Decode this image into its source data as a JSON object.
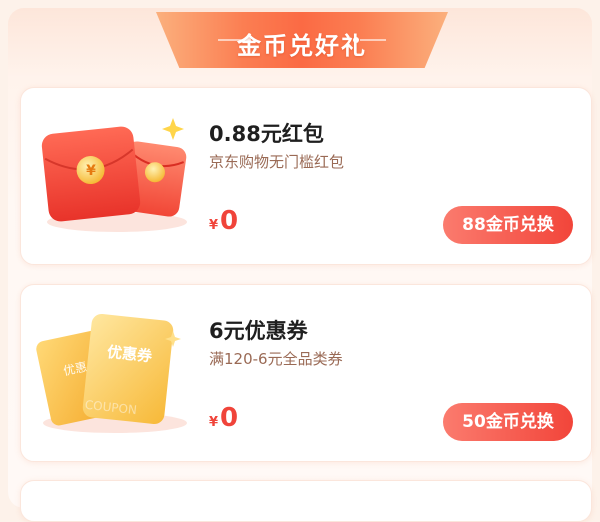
{
  "header": {
    "title": "金币兑好礼"
  },
  "items": [
    {
      "title": "0.88元红包",
      "description": "京东购物无门槛红包",
      "currency": "¥",
      "price": "0",
      "button_label": "88金币兑换",
      "image_icon": "red-envelope-icon",
      "coin_glyph": "¥"
    },
    {
      "title": "6元优惠券",
      "description": "满120-6元全品类券",
      "currency": "¥",
      "price": "0",
      "button_label": "50金币兑换",
      "image_icon": "coupon-icon",
      "coupon_text": "优惠券",
      "coupon_back_text": "优惠",
      "coupon_watermark": "COUPON"
    }
  ],
  "colors": {
    "accent": "#f2453a",
    "ribbon": "#fb6a44",
    "desc": "#9a6a55"
  }
}
